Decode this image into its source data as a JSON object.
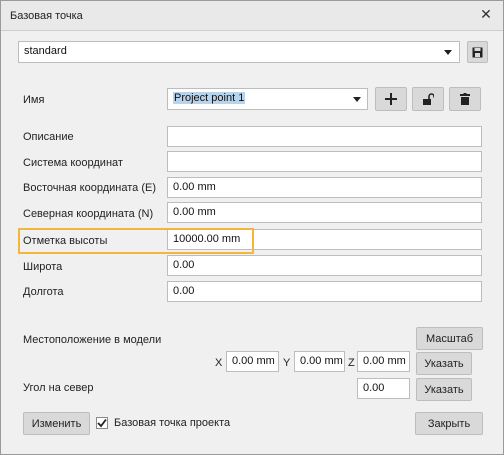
{
  "window": {
    "title": "Базовая точка",
    "close_glyph": "✕"
  },
  "preset": {
    "value": "standard",
    "save_icon": "save-icon"
  },
  "name_row": {
    "label": "Имя",
    "value": "Project point 1",
    "add_icon": "plus-icon",
    "unlock_icon": "unlock-icon",
    "delete_icon": "trash-icon"
  },
  "fields": [
    {
      "label": "Описание",
      "value": ""
    },
    {
      "label": "Система координат",
      "value": ""
    },
    {
      "label": "Восточная координата  (E)",
      "value": "0.00 mm"
    },
    {
      "label": "Северная координата  (N)",
      "value": "0.00 mm"
    },
    {
      "label": "Отметка высоты",
      "value": "10000.00 mm"
    },
    {
      "label": "Широта",
      "value": "0.00"
    },
    {
      "label": "Долгота",
      "value": "0.00"
    }
  ],
  "model_location": {
    "label": "Местоположение в модели",
    "scale_button": "Масштаб",
    "x_label": "X",
    "x_value": "0.00 mm",
    "y_label": "Y",
    "y_value": "0.00 mm",
    "z_label": "Z",
    "z_value": "0.00 mm",
    "specify_button": "Указать"
  },
  "north_angle": {
    "label": "Угол на север",
    "value": "0.00",
    "specify_button": "Указать"
  },
  "footer": {
    "edit_button": "Изменить",
    "project_point_label": "Базовая точка проекта",
    "project_point_checked": true,
    "close_button": "Закрыть"
  },
  "colors": {
    "highlight": "#f2b63a",
    "selection": "#b8d3ec"
  }
}
